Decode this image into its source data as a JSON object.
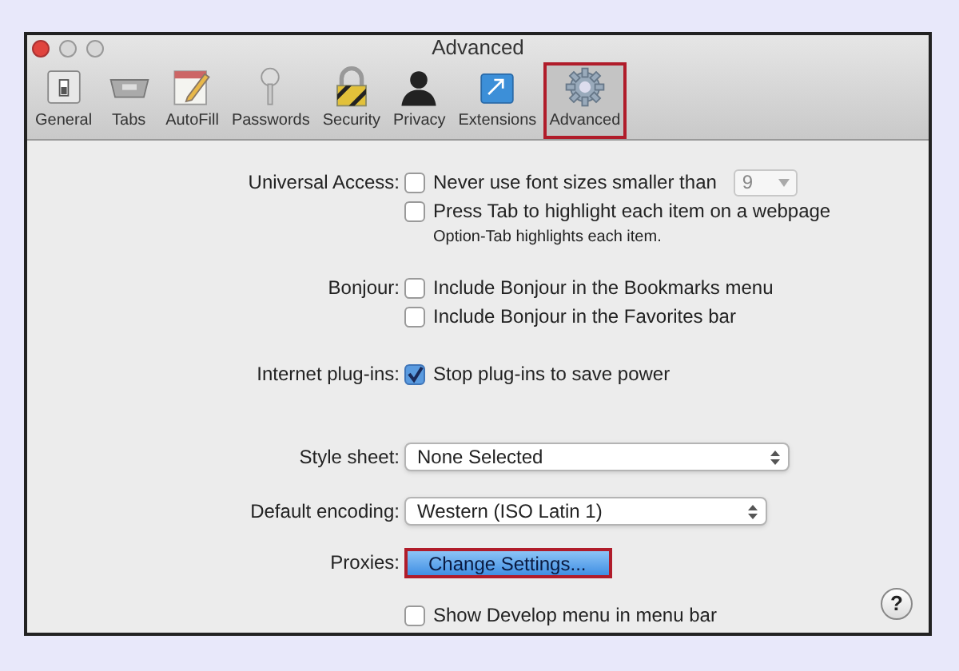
{
  "window": {
    "title": "Advanced"
  },
  "toolbar": [
    {
      "label": "General",
      "selected": false
    },
    {
      "label": "Tabs",
      "selected": false
    },
    {
      "label": "AutoFill",
      "selected": false
    },
    {
      "label": "Passwords",
      "selected": false
    },
    {
      "label": "Security",
      "selected": false
    },
    {
      "label": "Privacy",
      "selected": false
    },
    {
      "label": "Extensions",
      "selected": false
    },
    {
      "label": "Advanced",
      "selected": true
    }
  ],
  "sections": [
    {
      "label": "Universal Access:",
      "controls": [
        {
          "kind": "checkbox_select",
          "text": "Never use font sizes smaller than",
          "checked": false,
          "value": "9"
        },
        {
          "kind": "checkbox",
          "text": "Press Tab to highlight each item on a webpage",
          "checked": false
        },
        {
          "kind": "note",
          "text": "Option-Tab highlights each item."
        }
      ]
    },
    {
      "label": "Bonjour:",
      "controls": [
        {
          "kind": "checkbox",
          "text": "Include Bonjour in the Bookmarks menu",
          "checked": false
        },
        {
          "kind": "checkbox",
          "text": "Include Bonjour in the Favorites bar",
          "checked": false
        }
      ]
    },
    {
      "label": "Internet plug-ins:",
      "controls": [
        {
          "kind": "checkbox",
          "text": "Stop plug-ins to save power",
          "checked": true
        }
      ]
    },
    {
      "label": "Style sheet:",
      "controls": [
        {
          "kind": "select",
          "value": "None Selected"
        }
      ]
    },
    {
      "label": "Default encoding:",
      "controls": [
        {
          "kind": "select",
          "value": "Western (ISO Latin 1)"
        }
      ]
    },
    {
      "label": "Proxies:",
      "controls": [
        {
          "kind": "button",
          "text": "Change Settings..."
        }
      ]
    },
    {
      "controls": [
        {
          "kind": "checkbox",
          "text": "Show Develop menu in menu bar",
          "checked": false
        }
      ]
    }
  ],
  "help": "?"
}
